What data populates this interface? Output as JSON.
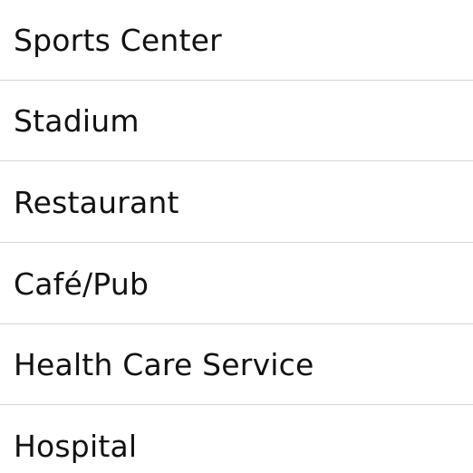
{
  "list": {
    "items": [
      {
        "label": "Sports Center"
      },
      {
        "label": "Stadium"
      },
      {
        "label": "Restaurant"
      },
      {
        "label": "Café/Pub"
      },
      {
        "label": "Health Care Service"
      },
      {
        "label": "Hospital"
      }
    ]
  }
}
